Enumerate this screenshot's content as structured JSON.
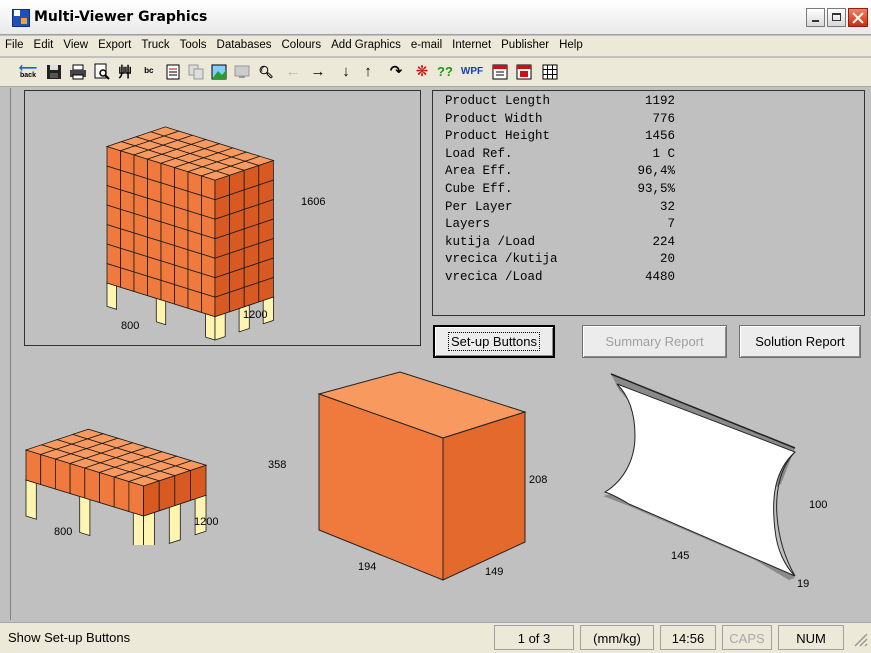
{
  "window": {
    "title": "Multi-Viewer Graphics",
    "app_icon": "cape-app-icon",
    "controls": [
      "minimize-icon",
      "maximize-icon",
      "close-icon"
    ]
  },
  "menu": [
    "File",
    "Edit",
    "View",
    "Export",
    "Truck",
    "Tools",
    "Databases",
    "Colours",
    "Add Graphics",
    "e-mail",
    "Internet",
    "Publisher",
    "Help"
  ],
  "toolbar": {
    "back_label": "back",
    "wpf_label": "WPF",
    "help_label": "??",
    "icons": [
      "back-arrow-icon",
      "save-icon",
      "print-icon",
      "print-preview-icon",
      "arrange-icon",
      "text-icon",
      "notes-icon",
      "copy-icon",
      "picture-icon",
      "monitor-icon",
      "zoom-icon",
      "left-arrow-disabled-icon",
      "right-arrow-icon",
      "down-arrow-icon",
      "up-arrow-icon",
      "rotate-icon",
      "settings-icon",
      "help-icon",
      "wpf-icon",
      "pdf-icon",
      "report-icon",
      "grid-icon"
    ]
  },
  "info": [
    {
      "label": "Product Length",
      "value": "1192"
    },
    {
      "label": "Product Width",
      "value": "776"
    },
    {
      "label": "Product Height",
      "value": "1456"
    },
    {
      "label": "Load Ref.",
      "value": "1 C"
    },
    {
      "label": "Area Eff.",
      "value": "96,4%"
    },
    {
      "label": "Cube Eff.",
      "value": "93,5%"
    },
    {
      "label": "Per Layer",
      "value": "32"
    },
    {
      "label": "Layers",
      "value": "7"
    },
    {
      "label": "kutija /Load",
      "value": "224"
    },
    {
      "label": "vrecica /kutija",
      "value": "20"
    },
    {
      "label": "vrecica /Load",
      "value": "4480"
    }
  ],
  "buttons": {
    "setup": "Set-up Buttons",
    "summary": "Summary Report",
    "solution": "Solution Report"
  },
  "graphics": {
    "pallet_load": {
      "height": "1606",
      "width": "800",
      "length": "1200"
    },
    "layer": {
      "height": "358",
      "width": "800",
      "length": "1200"
    },
    "case": {
      "height": "208",
      "width": "194",
      "length": "149"
    },
    "bag": {
      "height": "100",
      "length": "145",
      "thickness": "19"
    }
  },
  "colors": {
    "box_front": "#f07a3d",
    "box_side": "#d85a22",
    "box_top": "#f89a60",
    "pallet_board": "#fff4b0",
    "pallet_green": "#6b7a2a"
  },
  "status": {
    "message": "Show Set-up Buttons",
    "page": "1 of 3",
    "units": "(mm/kg)",
    "time": "14:56",
    "caps": "CAPS",
    "num": "NUM"
  }
}
